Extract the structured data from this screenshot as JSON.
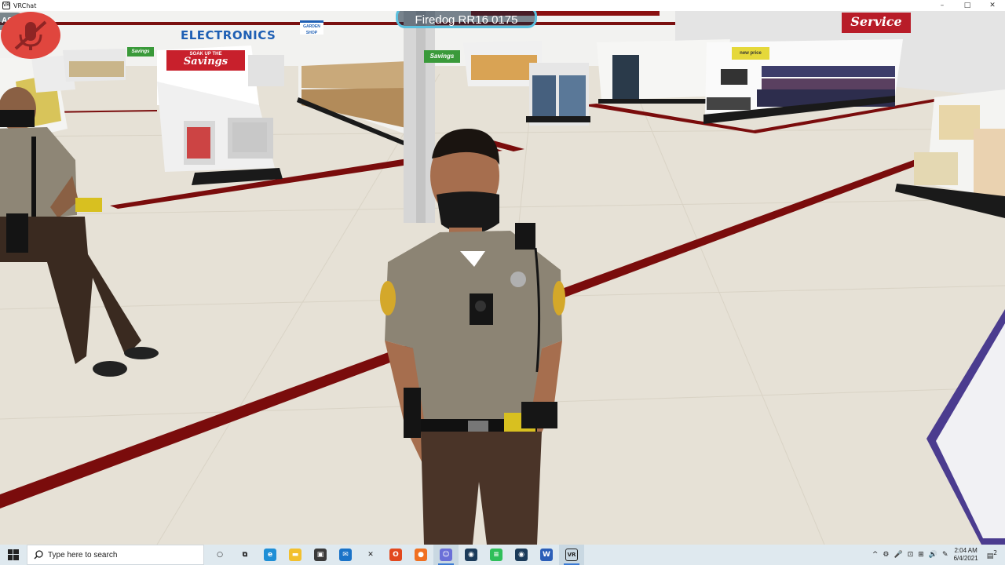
{
  "window": {
    "title": "VRChat",
    "app_icon_text": "VR",
    "controls": {
      "minimize": "–",
      "maximize": "□",
      "close": "✕"
    }
  },
  "game": {
    "nameplate": "Firedog RR16 0175",
    "signs": {
      "electronics": "ELECTRONICS",
      "service": "Service",
      "savings_main_small": "SOAK UP THE",
      "savings_main": "Savings",
      "savings_right": "Savings",
      "savings_left": "Savings",
      "new_price": "new price",
      "garden_shop": "GARDEN SHOP",
      "partial_left": "AS"
    },
    "hud": {
      "mic_muted_icon": "mic-muted-icon"
    }
  },
  "taskbar": {
    "search_placeholder": "Type here to search",
    "pinned": [
      {
        "name": "cortana",
        "glyph": "○",
        "color": "#222222"
      },
      {
        "name": "task-view",
        "glyph": "⧉",
        "color": "#222222"
      },
      {
        "name": "edge",
        "glyph": "e",
        "color": "#1f8fd6"
      },
      {
        "name": "file-explorer",
        "glyph": "▬",
        "color": "#f2c02e"
      },
      {
        "name": "store",
        "glyph": "▣",
        "color": "#3a3a3a"
      },
      {
        "name": "mail",
        "glyph": "✉",
        "color": "#1a73c8"
      },
      {
        "name": "xbox",
        "glyph": "✕",
        "color": "#222222"
      },
      {
        "name": "office",
        "glyph": "O",
        "color": "#e2491f"
      },
      {
        "name": "firefox",
        "glyph": "●",
        "color": "#f07022"
      },
      {
        "name": "discord",
        "glyph": "☺",
        "color": "#6a6fd8",
        "active": true
      },
      {
        "name": "steam-1",
        "glyph": "◉",
        "color": "#1b3b5a"
      },
      {
        "name": "spotify",
        "glyph": "≡",
        "color": "#2fbf5a"
      },
      {
        "name": "steam-2",
        "glyph": "◉",
        "color": "#1b3b5a"
      },
      {
        "name": "word",
        "glyph": "W",
        "color": "#2b5eb8"
      },
      {
        "name": "vrchat",
        "glyph": "VR",
        "color": "#222222",
        "active": true
      }
    ],
    "tray": {
      "chevron": "^",
      "icons": [
        "⚙",
        "🎤",
        "⊡",
        "⊞",
        "🔊",
        "✎"
      ],
      "time": "2:04 AM",
      "date": "6/4/2021",
      "notification_count": "2"
    }
  }
}
